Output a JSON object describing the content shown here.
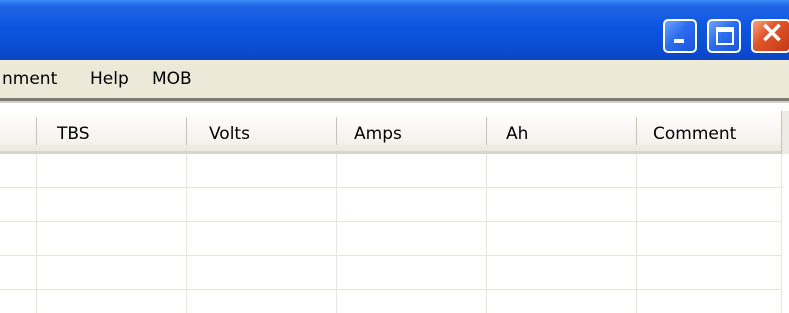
{
  "window": {
    "controls": {
      "minimize": "minimize-icon",
      "maximize": "maximize-icon",
      "close": "close-icon",
      "close_glyph": "×"
    },
    "titlebar_color": "#0a4fd6",
    "close_color": "#e0552a"
  },
  "menu": {
    "items": [
      "nment",
      "Help",
      "MOB"
    ]
  },
  "grid": {
    "columns": [
      "TBS",
      "Volts",
      "Amps",
      "Ah",
      "Comment"
    ],
    "rows": [
      [
        "",
        "",
        "",
        "",
        ""
      ],
      [
        "",
        "",
        "",
        "",
        ""
      ],
      [
        "",
        "",
        "",
        "",
        ""
      ],
      [
        "",
        "",
        "",
        "",
        ""
      ],
      [
        "",
        "",
        "",
        "",
        ""
      ]
    ]
  }
}
